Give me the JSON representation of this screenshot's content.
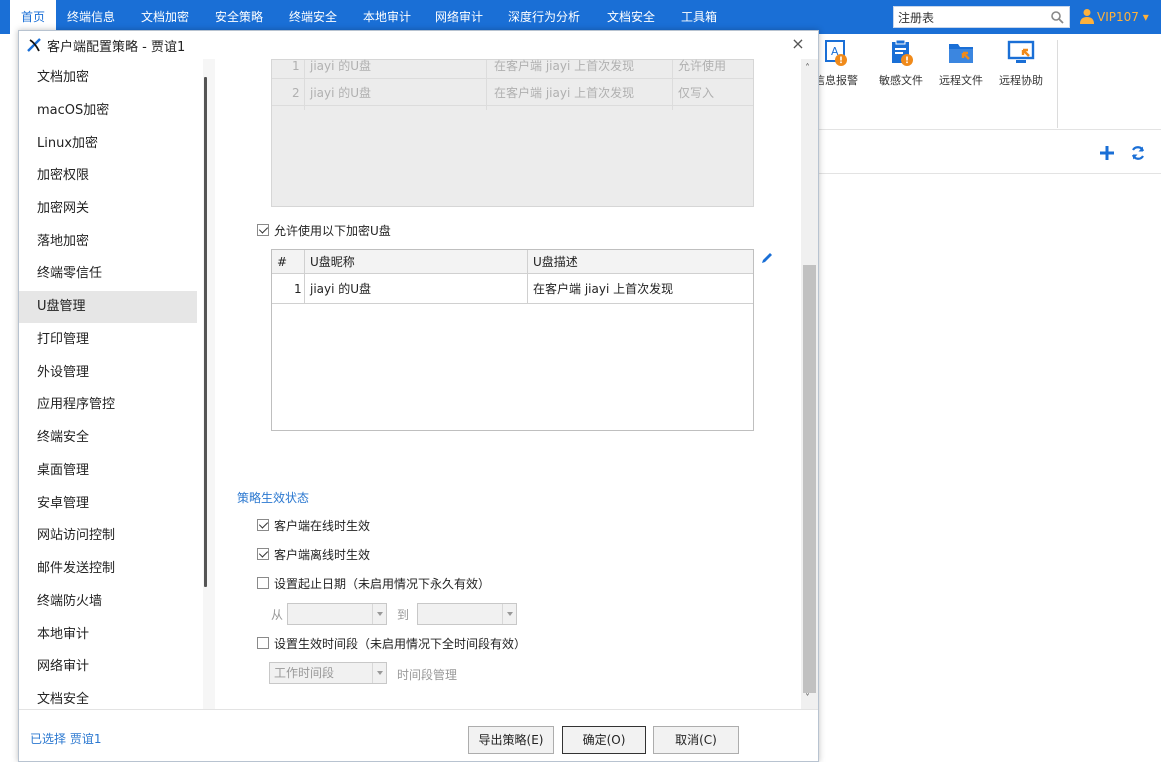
{
  "topnav": {
    "items": [
      "首页",
      "终端信息",
      "文档加密",
      "安全策略",
      "终端安全",
      "本地审计",
      "网络审计",
      "深度行为分析",
      "文档安全",
      "工具箱"
    ],
    "active_index": 0,
    "search_value": "注册表",
    "user": "VIP107"
  },
  "toolbar": {
    "tools": [
      "信息报警",
      "敏感文件",
      "远程文件",
      "远程协助"
    ]
  },
  "colors": {
    "nav_bg": "#1a6fd6",
    "accent": "#2b78d0",
    "user": "#ffb13b"
  },
  "dialog": {
    "title": "客户端配置策略 - 贾谊1",
    "close_glyph": "×",
    "sidebar": {
      "items": [
        "文档加密",
        "macOS加密",
        "Linux加密",
        "加密权限",
        "加密网关",
        "落地加密",
        "终端零信任",
        "U盘管理",
        "打印管理",
        "外设管理",
        "应用程序管控",
        "终端安全",
        "桌面管理",
        "安卓管理",
        "网站访问控制",
        "邮件发送控制",
        "终端防火墙",
        "本地审计",
        "网络审计",
        "文档安全"
      ],
      "active_index": 7
    },
    "grayed_table": {
      "rows": [
        {
          "num": "1",
          "name": "jiayi 的U盘",
          "desc": "在客户端 jiayi 上首次发现",
          "perm": "允许使用"
        },
        {
          "num": "2",
          "name": "jiayi 的U盘",
          "desc": "在客户端 jiayi 上首次发现",
          "perm": "仅写入"
        }
      ]
    },
    "allow_encrypted": {
      "label": "允许使用以下加密U盘",
      "checked": true
    },
    "usb_table": {
      "headers": [
        "#",
        "U盘昵称",
        "U盘描述"
      ],
      "rows": [
        {
          "num": "1",
          "name": "jiayi 的U盘",
          "desc": "在客户端 jiayi 上首次发现"
        }
      ]
    },
    "effect": {
      "title": "策略生效状态",
      "online": {
        "label": "客户端在线时生效",
        "checked": true
      },
      "offline": {
        "label": "客户端离线时生效",
        "checked": true
      },
      "date_range": {
        "label": "设置起止日期（未启用情况下永久有效）",
        "checked": false,
        "from_label": "从",
        "to_label": "到"
      },
      "time_range": {
        "label": "设置生效时间段（未启用情况下全时间段有效）",
        "checked": false,
        "select_value": "工作时间段",
        "manage_label": "时间段管理"
      }
    },
    "footer": {
      "selected_text": "已选择 贾谊1",
      "export_label": "导出策略(E)",
      "ok_label": "确定(O)",
      "cancel_label": "取消(C)"
    }
  }
}
